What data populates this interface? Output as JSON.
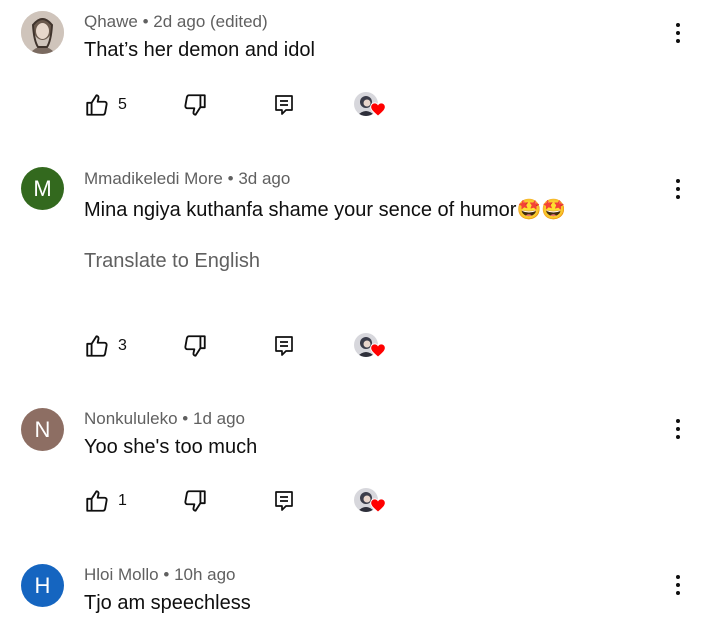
{
  "comments": [
    {
      "author": "Qhawe",
      "time": "2d ago (edited)",
      "text": "That’s her demon and idol",
      "avatar": {
        "type": "photo"
      },
      "likes": "5"
    },
    {
      "author": "Mmadikeledi More",
      "time": "3d ago",
      "text": "Mina ngiya kuthanfa shame your sence of humor",
      "emoji": "🤩🤩",
      "translate": "Translate to English",
      "avatar": {
        "type": "letter",
        "letter": "M",
        "color": "#33691e"
      },
      "likes": "3"
    },
    {
      "author": "Nonkululeko",
      "time": "1d ago",
      "text": "Yoo she's too much",
      "avatar": {
        "type": "letter",
        "letter": "N",
        "color": "#8d6e63"
      },
      "likes": "1"
    },
    {
      "author": "Hloi Mollo",
      "time": "10h ago",
      "text": "Tjo am speechless",
      "avatar": {
        "type": "letter",
        "letter": "H",
        "color": "#1565c0"
      }
    }
  ],
  "separator": "•",
  "icons": {
    "like": "thumbs-up-icon",
    "dislike": "thumbs-down-icon",
    "reply": "reply-icon",
    "more": "more-vertical-icon",
    "creator_heart": "creator-heart-icon"
  },
  "colors": {
    "heart": "#ff0000",
    "meta_text": "#606060",
    "text": "#0f0f0f"
  }
}
